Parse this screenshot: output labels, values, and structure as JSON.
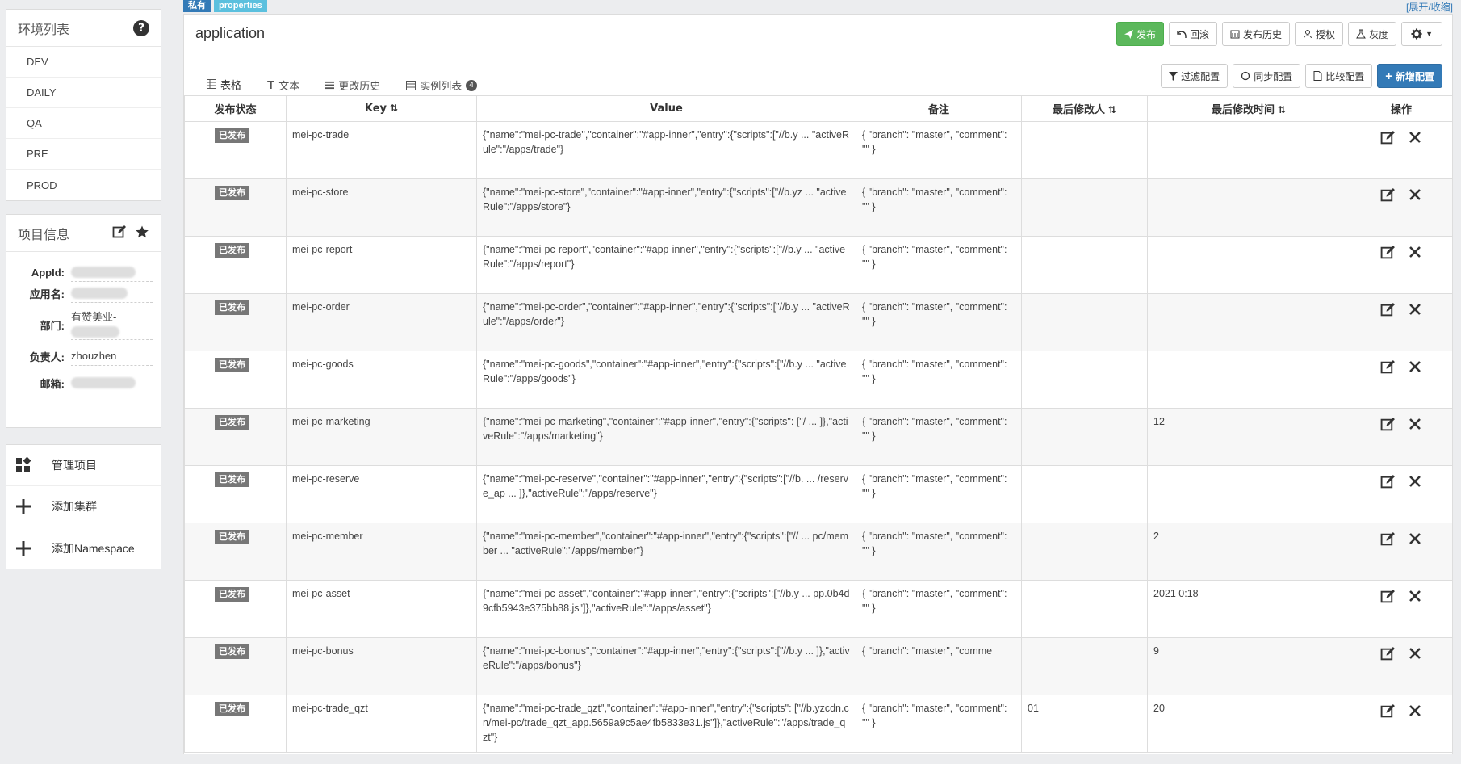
{
  "env_panel": {
    "title": "环境列表",
    "envs": [
      "DEV",
      "DAILY",
      "QA",
      "PRE",
      "PROD"
    ]
  },
  "project_panel": {
    "title": "项目信息",
    "fields": [
      {
        "key": "AppId:",
        "value": ""
      },
      {
        "key": "应用名:",
        "value": ""
      },
      {
        "key": "部门:",
        "value": "有赞美业-"
      },
      {
        "key": "负责人:",
        "value": "zhouzhen"
      },
      {
        "key": "邮箱:",
        "value": ""
      }
    ]
  },
  "actions": {
    "manage": "管理项目",
    "add_cluster": "添加集群",
    "add_namespace": "添加Namespace"
  },
  "tags": {
    "private": "私有",
    "format": "properties"
  },
  "expand_link": "[展开/收缩]",
  "namespace": {
    "title": "application"
  },
  "toolbar": {
    "publish": "发布",
    "rollback": "回滚",
    "history": "发布历史",
    "grant": "授权",
    "gray": "灰度"
  },
  "tabs": [
    {
      "label": "表格"
    },
    {
      "label": "文本"
    },
    {
      "label": "更改历史"
    },
    {
      "label": "实例列表",
      "badge": "4"
    }
  ],
  "toolbar2": {
    "filter": "过滤配置",
    "sync": "同步配置",
    "compare": "比较配置",
    "add": "新增配置"
  },
  "table": {
    "headers": {
      "status": "发布状态",
      "key": "Key",
      "value": "Value",
      "note": "备注",
      "modifier": "最后修改人",
      "time": "最后修改时间",
      "ops": "操作"
    },
    "rows": [
      {
        "status": "已发布",
        "key": "mei-pc-trade",
        "value": "{\"name\":\"mei-pc-trade\",\"container\":\"#app-inner\",\"entry\":{\"scripts\":[\"//b.y ... \"activeRule\":\"/apps/trade\"}",
        "note": "{ \"branch\": \"master\", \"comment\": \"\" }",
        "modifier": "",
        "time": ""
      },
      {
        "status": "已发布",
        "key": "mei-pc-store",
        "value": "{\"name\":\"mei-pc-store\",\"container\":\"#app-inner\",\"entry\":{\"scripts\":[\"//b.yz ... \"activeRule\":\"/apps/store\"}",
        "note": "{ \"branch\": \"master\", \"comment\": \"\" }",
        "modifier": "",
        "time": ""
      },
      {
        "status": "已发布",
        "key": "mei-pc-report",
        "value": "{\"name\":\"mei-pc-report\",\"container\":\"#app-inner\",\"entry\":{\"scripts\":[\"//b.y ... \"activeRule\":\"/apps/report\"}",
        "note": "{ \"branch\": \"master\", \"comment\": \"\" }",
        "modifier": "",
        "time": ""
      },
      {
        "status": "已发布",
        "key": "mei-pc-order",
        "value": "{\"name\":\"mei-pc-order\",\"container\":\"#app-inner\",\"entry\":{\"scripts\":[\"//b.y ... \"activeRule\":\"/apps/order\"}",
        "note": "{ \"branch\": \"master\", \"comment\": \"\" }",
        "modifier": "",
        "time": ""
      },
      {
        "status": "已发布",
        "key": "mei-pc-goods",
        "value": "{\"name\":\"mei-pc-goods\",\"container\":\"#app-inner\",\"entry\":{\"scripts\":[\"//b.y ... \"activeRule\":\"/apps/goods\"}",
        "note": "{ \"branch\": \"master\", \"comment\": \"\" }",
        "modifier": "",
        "time": ""
      },
      {
        "status": "已发布",
        "key": "mei-pc-marketing",
        "value": "{\"name\":\"mei-pc-marketing\",\"container\":\"#app-inner\",\"entry\":{\"scripts\": [\"/ ... ]},\"activeRule\":\"/apps/marketing\"}",
        "note": "{ \"branch\": \"master\", \"comment\": \"\" }",
        "modifier": "",
        "time": "12"
      },
      {
        "status": "已发布",
        "key": "mei-pc-reserve",
        "value": "{\"name\":\"mei-pc-reserve\",\"container\":\"#app-inner\",\"entry\":{\"scripts\":[\"//b. ... /reserve_ap ... ]},\"activeRule\":\"/apps/reserve\"}",
        "note": "{ \"branch\": \"master\", \"comment\": \"\" }",
        "modifier": "",
        "time": ""
      },
      {
        "status": "已发布",
        "key": "mei-pc-member",
        "value": "{\"name\":\"mei-pc-member\",\"container\":\"#app-inner\",\"entry\":{\"scripts\":[\"// ... pc/member ... \"activeRule\":\"/apps/member\"}",
        "note": "{ \"branch\": \"master\", \"comment\": \"\" }",
        "modifier": "",
        "time": "2"
      },
      {
        "status": "已发布",
        "key": "mei-pc-asset",
        "value": "{\"name\":\"mei-pc-asset\",\"container\":\"#app-inner\",\"entry\":{\"scripts\":[\"//b.y ... pp.0b4d9cfb5943e375bb88.js\"]},\"activeRule\":\"/apps/asset\"}",
        "note": "{ \"branch\": \"master\", \"comment\": \"\" }",
        "modifier": "",
        "time": "2021 0:18"
      },
      {
        "status": "已发布",
        "key": "mei-pc-bonus",
        "value": "{\"name\":\"mei-pc-bonus\",\"container\":\"#app-inner\",\"entry\":{\"scripts\":[\"//b.y ... ]},\"activeRule\":\"/apps/bonus\"}",
        "note": "{ \"branch\": \"master\", \"comme",
        "modifier": "",
        "time": "9"
      },
      {
        "status": "已发布",
        "key": "mei-pc-trade_qzt",
        "value": "{\"name\":\"mei-pc-trade_qzt\",\"container\":\"#app-inner\",\"entry\":{\"scripts\": [\"//b.yzcdn.cn/mei-pc/trade_qzt_app.5659a9c5ae4fb5833e31.js\"]},\"activeRule\":\"/apps/trade_qzt\"}",
        "note": "{ \"branch\": \"master\", \"comment\": \"\" }",
        "modifier": "01",
        "time": "20"
      }
    ]
  }
}
